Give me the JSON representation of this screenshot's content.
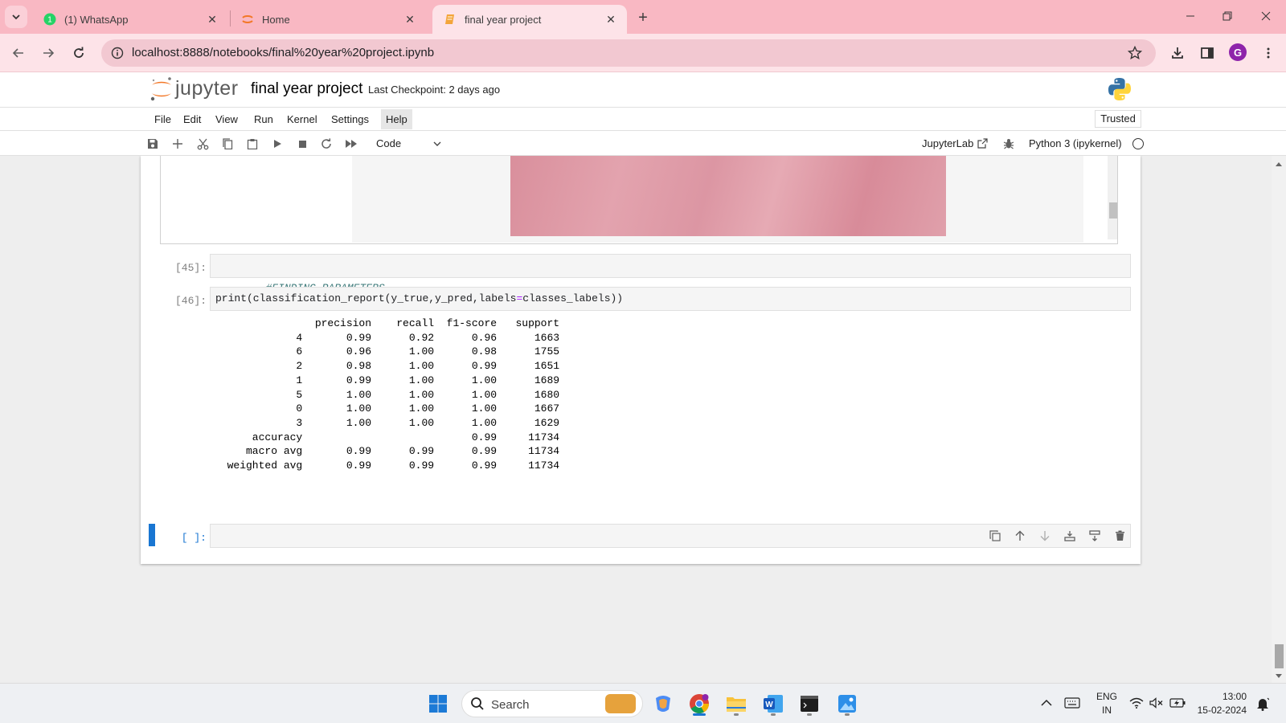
{
  "browser": {
    "tabs": [
      {
        "title": "(1) WhatsApp",
        "icon": "whatsapp-icon",
        "active": false
      },
      {
        "title": "Home",
        "icon": "jupyter-icon",
        "active": false
      },
      {
        "title": "final year project",
        "icon": "notebook-icon",
        "active": true
      }
    ],
    "url": "localhost:8888/notebooks/final%20year%20project.ipynb",
    "profile_initial": "G"
  },
  "jupyter": {
    "wordmark": "jupyter",
    "notebook_title": "final year project",
    "checkpoint": "Last Checkpoint: 2 days ago",
    "menu": [
      "File",
      "Edit",
      "View",
      "Run",
      "Kernel",
      "Settings",
      "Help"
    ],
    "active_menu": "Help",
    "trusted": "Trusted",
    "cell_type": "Code",
    "jupyterlab_link": "JupyterLab",
    "kernel": "Python 3 (ipykernel)"
  },
  "cells": [
    {
      "prompt": "[45]:",
      "source": "#FINDING PARAMETERS"
    },
    {
      "prompt": "[46]:",
      "source_parts": [
        "print(classification_report(y_true,y_pred,labels",
        "=",
        "classes_labels))"
      ]
    },
    {
      "prompt": "[ ]:",
      "source": ""
    }
  ],
  "classification_report": {
    "header": [
      "precision",
      "recall",
      "f1-score",
      "support"
    ],
    "rows": [
      {
        "label": "4",
        "precision": "0.99",
        "recall": "0.92",
        "f1": "0.96",
        "support": "1663"
      },
      {
        "label": "6",
        "precision": "0.96",
        "recall": "1.00",
        "f1": "0.98",
        "support": "1755"
      },
      {
        "label": "2",
        "precision": "0.98",
        "recall": "1.00",
        "f1": "0.99",
        "support": "1651"
      },
      {
        "label": "1",
        "precision": "0.99",
        "recall": "1.00",
        "f1": "1.00",
        "support": "1689"
      },
      {
        "label": "5",
        "precision": "1.00",
        "recall": "1.00",
        "f1": "1.00",
        "support": "1680"
      },
      {
        "label": "0",
        "precision": "1.00",
        "recall": "1.00",
        "f1": "1.00",
        "support": "1667"
      },
      {
        "label": "3",
        "precision": "1.00",
        "recall": "1.00",
        "f1": "1.00",
        "support": "1629"
      }
    ],
    "summary": [
      {
        "label": "accuracy",
        "precision": "",
        "recall": "",
        "f1": "0.99",
        "support": "11734"
      },
      {
        "label": "macro avg",
        "precision": "0.99",
        "recall": "0.99",
        "f1": "0.99",
        "support": "11734"
      },
      {
        "label": "weighted avg",
        "precision": "0.99",
        "recall": "0.99",
        "f1": "0.99",
        "support": "11734"
      }
    ]
  },
  "taskbar": {
    "search_label": "Search",
    "language": [
      "ENG",
      "IN"
    ],
    "time": "13:00",
    "date": "15-02-2024"
  }
}
